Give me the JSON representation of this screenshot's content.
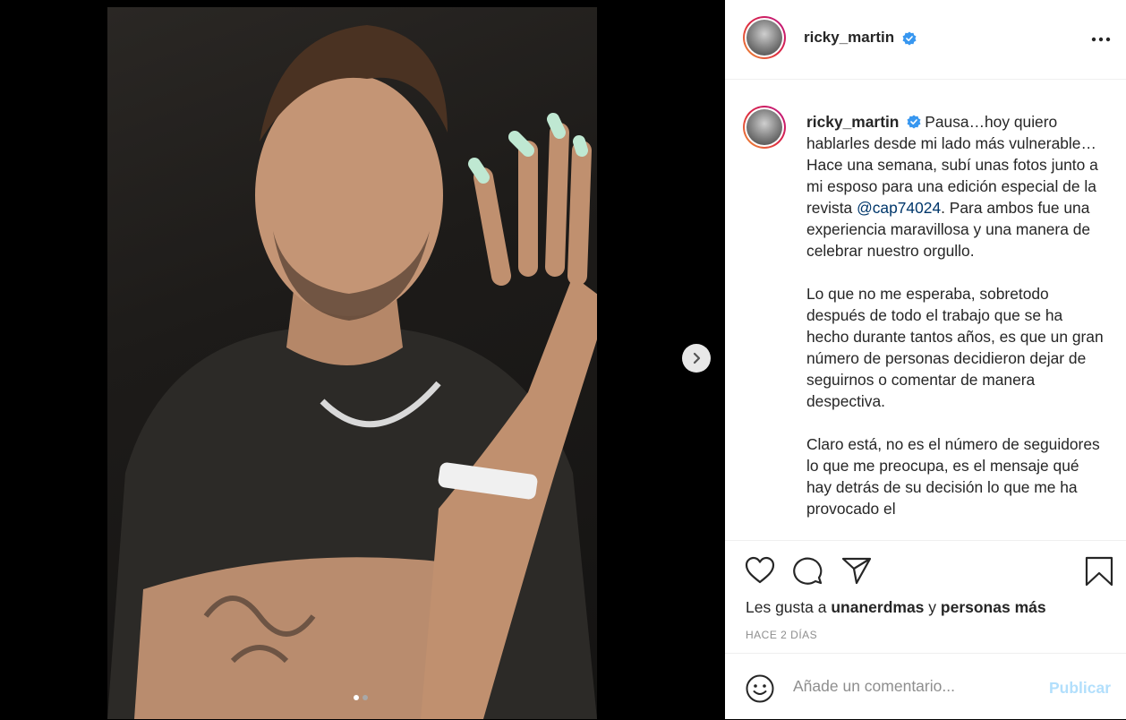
{
  "post": {
    "username": "ricky_martin",
    "more_icon": "more-horizontal-icon",
    "image_alt": "post-photo",
    "carousel": {
      "current": 1,
      "total": 2
    }
  },
  "caption": {
    "username": "ricky_martin",
    "p1_a": "Pausa…hoy quiero hablarles desde mi lado más vulnerable… Hace una semana, subí unas fotos junto a mi esposo para una edición especial de la revista ",
    "mention": "@cap74024",
    "p1_b": ". Para ambos fue una experiencia maravillosa y una manera de celebrar nuestro orgullo.",
    "p2": "Lo que no me esperaba, sobretodo después de todo el trabajo que se ha hecho durante tantos años, es que un gran número de personas decidieron dejar de seguirnos o comentar de manera despectiva.",
    "p3": "Claro está, no es el número de seguidores lo que me preocupa, es el mensaje qué hay detrás de su decisión lo que me ha provocado el"
  },
  "actions": {
    "like_icon": "heart-icon",
    "comment_icon": "comment-icon",
    "share_icon": "send-icon",
    "save_icon": "bookmark-icon"
  },
  "likes": {
    "prefix": "Les gusta a ",
    "user": "unanerdmas",
    "middle": " y ",
    "others": "personas más"
  },
  "timestamp": "HACE 2 DÍAS",
  "comment": {
    "placeholder": "Añade un comentario...",
    "publish_label": "Publicar"
  },
  "colors": {
    "verified": "#3897f0",
    "link": "#00376b",
    "publish_disabled": "#b2dffc"
  }
}
